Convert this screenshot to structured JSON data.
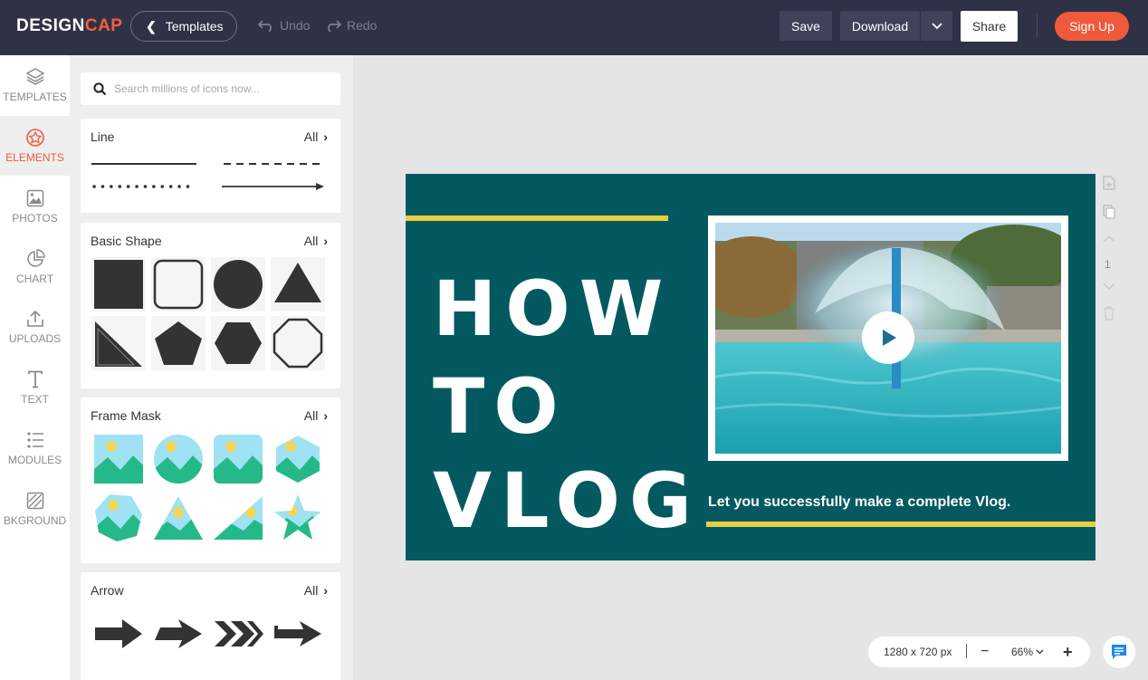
{
  "header": {
    "logo_design": "DESIGN",
    "logo_cap": "CAP",
    "templates_label": "Templates",
    "undo_label": "Undo",
    "redo_label": "Redo",
    "save_label": "Save",
    "download_label": "Download",
    "share_label": "Share",
    "signup_label": "Sign Up"
  },
  "sidebar": {
    "items": [
      {
        "label": "TEMPLATES",
        "icon": "layers-icon"
      },
      {
        "label": "ELEMENTS",
        "icon": "elements-icon",
        "active": true
      },
      {
        "label": "PHOTOS",
        "icon": "image-icon"
      },
      {
        "label": "CHART",
        "icon": "pie-chart-icon"
      },
      {
        "label": "UPLOADS",
        "icon": "upload-icon"
      },
      {
        "label": "TEXT",
        "icon": "text-icon"
      },
      {
        "label": "MODULES",
        "icon": "list-icon"
      },
      {
        "label": "BKGROUND",
        "icon": "background-icon"
      }
    ]
  },
  "panel": {
    "search_placeholder": "Search millions of icons now...",
    "sections": [
      {
        "title": "Line",
        "all_label": "All"
      },
      {
        "title": "Basic Shape",
        "all_label": "All"
      },
      {
        "title": "Frame Mask",
        "all_label": "All"
      },
      {
        "title": "Arrow",
        "all_label": "All"
      }
    ]
  },
  "design": {
    "line1": "HOW",
    "line2": "TO",
    "line3": "VLOG",
    "subtitle": "Let you successfully make a complete Vlog.",
    "bg_color": "#03595f",
    "accent_color": "#e8cf3f"
  },
  "side_tools": {
    "page_number": "1"
  },
  "zoom": {
    "size_label": "1280 x 720 px",
    "zoom_label": "66%",
    "minus": "−",
    "plus": "+"
  },
  "colors": {
    "brand_orange": "#ef5a3c",
    "topbar": "#2f3147"
  }
}
